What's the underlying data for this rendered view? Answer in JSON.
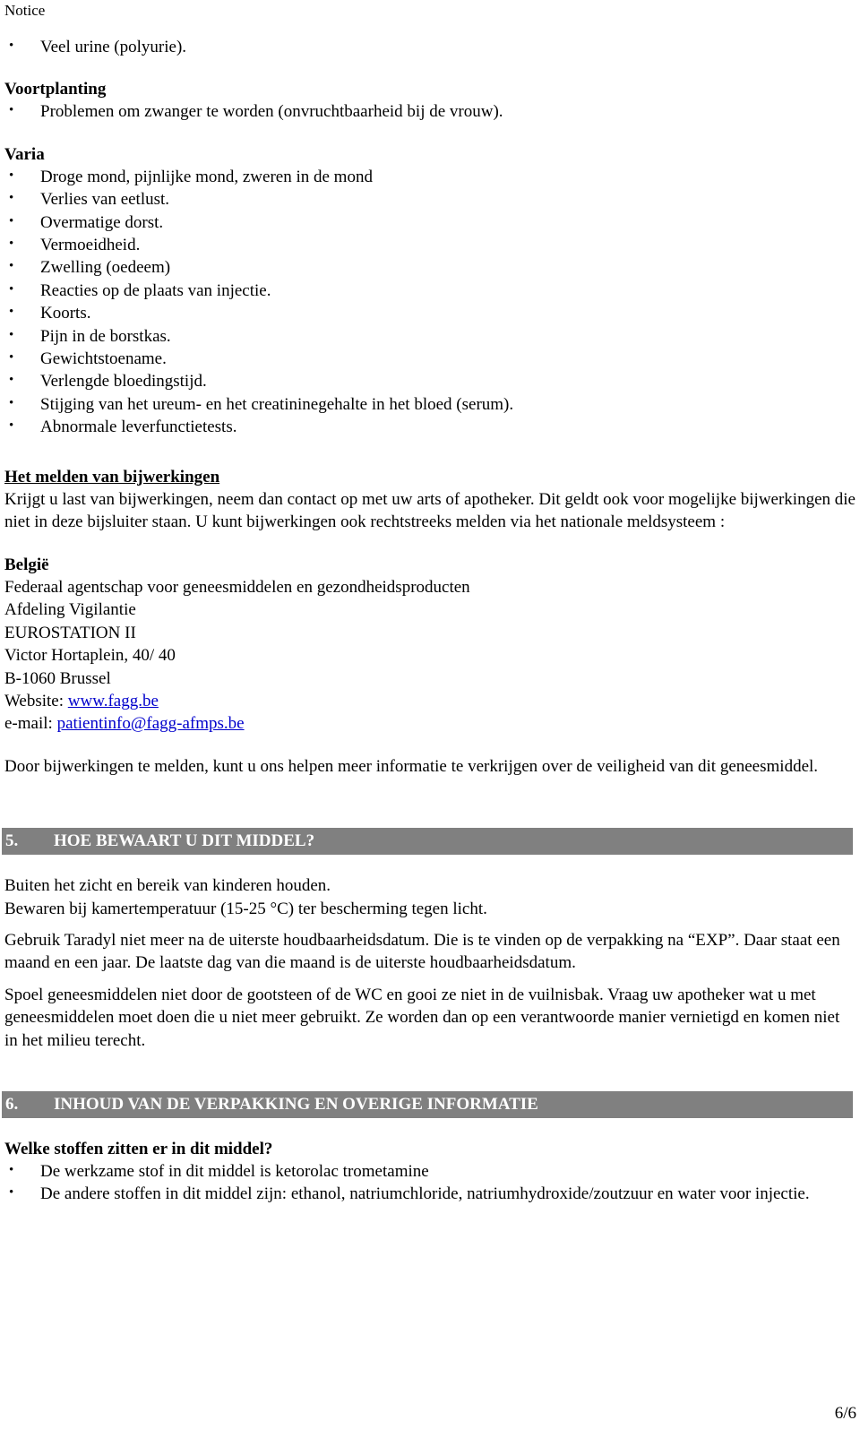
{
  "document": {
    "header_label": "Notice",
    "page_number": "6/6"
  },
  "first_bullets": [
    "Veel urine (polyurie)."
  ],
  "sections": {
    "voortplanting": {
      "title": "Voortplanting",
      "bullets": [
        "Problemen om zwanger te worden (onvruchtbaarheid bij de vrouw)."
      ]
    },
    "varia": {
      "title": "Varia",
      "bullets": [
        "Droge mond, pijnlijke mond, zweren in de mond",
        "Verlies van eetlust.",
        "Overmatige dorst.",
        "Vermoeidheid.",
        "Zwelling (oedeem)",
        "Reacties op de plaats van injectie.",
        "Koorts.",
        "Pijn in de borstkas.",
        "Gewichtstoename.",
        "Verlengde bloedingstijd.",
        "Stijging van het ureum- en het creatininegehalte in het bloed (serum).",
        "Abnormale leverfunctietests."
      ]
    },
    "melden": {
      "title": "Het melden van bijwerkingen",
      "paragraph": "Krijgt u last van bijwerkingen, neem dan contact op met uw arts of apotheker. Dit geldt ook voor mogelijke bijwerkingen die niet in deze bijsluiter staan. U kunt bijwerkingen ook rechtstreeks melden via het nationale meldsysteem :",
      "address": {
        "country": "België",
        "line1": "Federaal agentschap voor geneesmiddelen en gezondheidsproducten",
        "line2": "Afdeling Vigilantie",
        "line3": "EUROSTATION II",
        "line4": "Victor Hortaplein, 40/ 40",
        "line5": "B-1060 Brussel",
        "website_label": "Website: ",
        "website_url": "www.fagg.be",
        "email_label": "e-mail: ",
        "email_address": "patientinfo@fagg-afmps.be"
      },
      "closing_paragraph": "Door bijwerkingen te melden, kunt u ons helpen meer informatie te verkrijgen over de veiligheid van dit geneesmiddel."
    },
    "section5": {
      "number": "5.",
      "title": "HOE BEWAART U DIT MIDDEL?",
      "para1_line1": "Buiten het zicht en bereik van kinderen houden.",
      "para1_line2": "Bewaren bij kamertemperatuur (15-25 °C) ter bescherming tegen licht.",
      "para2": "Gebruik Taradyl niet meer na de uiterste houdbaarheidsdatum. Die is te vinden op de verpakking na “EXP”. Daar staat een maand en een jaar. De laatste dag van die maand is de uiterste houdbaarheidsdatum.",
      "para3": "Spoel geneesmiddelen niet door de gootsteen of de WC en gooi ze niet in de vuilnisbak. Vraag uw apotheker wat u met geneesmiddelen moet doen die u niet meer gebruikt. Ze worden dan op een verantwoorde manier vernietigd en komen niet in het milieu terecht."
    },
    "section6": {
      "number": "6.",
      "title": "INHOUD VAN DE VERPAKKING EN OVERIGE INFORMATIE",
      "subtitle": "Welke stoffen zitten er in dit middel?",
      "bullets": [
        "De werkzame stof in dit middel is ketorolac trometamine",
        "De andere stoffen in dit middel zijn: ethanol, natriumchloride, natriumhydroxide/zoutzuur en water voor injectie."
      ]
    }
  },
  "colors": {
    "section_bar_bg": "#808080",
    "section_bar_text": "#ffffff",
    "link": "#0000cc",
    "body_text": "#000000"
  }
}
